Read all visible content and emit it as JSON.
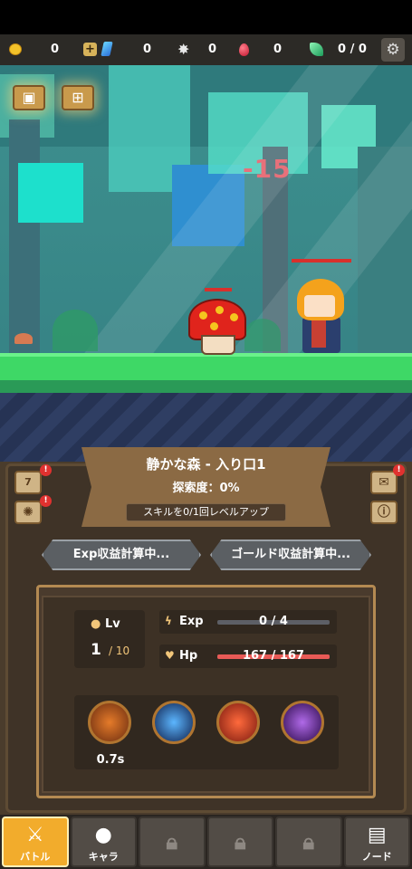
{
  "resources": {
    "gold": "0",
    "gems": "0",
    "stars": "0",
    "rubies": "0",
    "leaves": "0 / 0",
    "add_symbol": "+"
  },
  "scene": {
    "damage_text": "-15",
    "hud_buttons": [
      "mailbox-icon",
      "gift-icon"
    ]
  },
  "stage": {
    "title": "静かな森 - 入り口1",
    "explore": "探索度：0%",
    "skill_levelup": "スキルを0/1回レベルアップ",
    "side_left_top": "7",
    "side_left_badge": "!",
    "side_left_bottom_badge": "!",
    "side_right_badge": "!"
  },
  "calc": {
    "exp": "Exp収益計算中...",
    "gold": "ゴールド収益計算中..."
  },
  "player": {
    "lv_label": "Lv",
    "lv_value": "1",
    "lv_max": "/ 10",
    "exp_label": "Exp",
    "exp_text": "0 / 4",
    "exp_fraction": 0.0,
    "hp_label": "Hp",
    "hp_text": "167 / 167",
    "hp_fraction": 1.0,
    "cooldown": "0.7s"
  },
  "nav": {
    "battle": "バトル",
    "chara": "キャラ",
    "note": "ノード"
  },
  "colors": {
    "accent": "#f2ac2c",
    "hp": "#e85a56",
    "ground": "#3ed866"
  }
}
